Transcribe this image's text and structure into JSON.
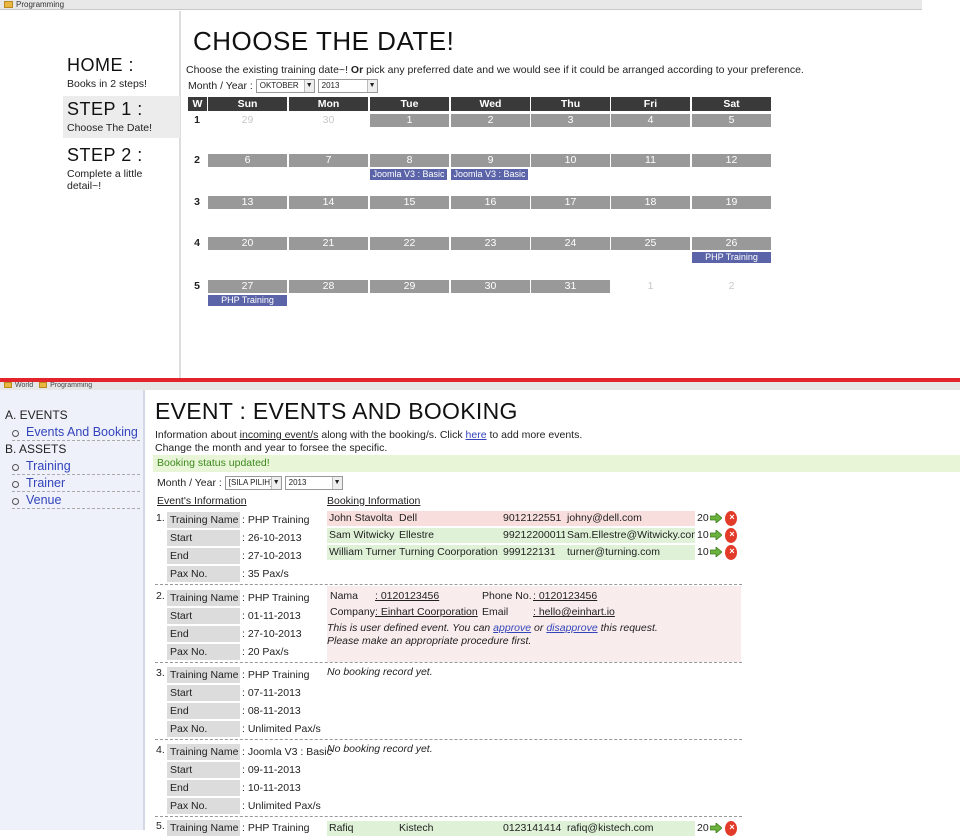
{
  "top": {
    "bookmark": "Programming",
    "steps": [
      {
        "heading": "HOME :",
        "sub": "Books in 2 steps!"
      },
      {
        "heading": "STEP 1 :",
        "sub": "Choose The Date!"
      },
      {
        "heading": "STEP 2 :",
        "sub": "Complete a little detail~!"
      }
    ],
    "title": "CHOOSE THE DATE!",
    "intro_a": "Choose the existing training date~!",
    "intro_or": "Or",
    "intro_b": "pick any preferred date and we would see if it could be arranged according to your preference.",
    "month_year_label": "Month / Year :",
    "month_value": "OKTOBER",
    "year_value": "2013",
    "calendar": {
      "headers": [
        "W",
        "Sun",
        "Mon",
        "Tue",
        "Wed",
        "Thu",
        "Fri",
        "Sat"
      ],
      "weeks": [
        {
          "w": "1",
          "days": [
            "29",
            "30",
            "1",
            "2",
            "3",
            "4",
            "5"
          ],
          "outside": [
            0,
            1
          ]
        },
        {
          "w": "2",
          "days": [
            "6",
            "7",
            "8",
            "9",
            "10",
            "11",
            "12"
          ],
          "outside": []
        },
        {
          "w": "3",
          "days": [
            "13",
            "14",
            "15",
            "16",
            "17",
            "18",
            "19"
          ],
          "outside": []
        },
        {
          "w": "4",
          "days": [
            "20",
            "21",
            "22",
            "23",
            "24",
            "25",
            "26"
          ],
          "outside": []
        },
        {
          "w": "5",
          "days": [
            "27",
            "28",
            "29",
            "30",
            "31",
            "1",
            "2"
          ],
          "outside": [
            5,
            6
          ]
        }
      ],
      "events": [
        {
          "week": 1,
          "day": 2,
          "label": "Joomla V3 : Basic"
        },
        {
          "week": 1,
          "day": 3,
          "label": "Joomla V3 : Basic"
        },
        {
          "week": 3,
          "day": 6,
          "label": "PHP Training"
        },
        {
          "week": 4,
          "day": 0,
          "label": "PHP Training"
        }
      ]
    }
  },
  "bottom": {
    "bookmarks": [
      "World",
      "Programming"
    ],
    "sidebar": {
      "sec_a": "A.  EVENTS",
      "events_link": "Events And Booking",
      "sec_b": "B.  ASSETS",
      "training": "Training",
      "trainer": "Trainer",
      "venue": "Venue"
    },
    "title": "EVENT : EVENTS AND BOOKING",
    "info1_a": "Information about",
    "info1_link": "incoming event/s",
    "info1_b": "along with the booking/s. Click",
    "info1_here": "here",
    "info1_c": "to add more events.",
    "info2": "Change the month and year to forsee the specific.",
    "status": "Booking status updated!",
    "month_year_label": "Month / Year :",
    "month_value": "[SILA PILIH]",
    "year_value": "2013",
    "col_event": "Event's Information",
    "col_booking": "Booking Information",
    "labels": {
      "name": "Training Name",
      "start": "Start",
      "end": "End",
      "pax": "Pax No."
    },
    "events": [
      {
        "num": "1.",
        "name": ": PHP Training",
        "start": ": 26-10-2013",
        "end": ": 27-10-2013",
        "pax": ": 35 Pax/s"
      },
      {
        "num": "2.",
        "name": ": PHP Training",
        "start": ": 01-11-2013",
        "end": ": 27-10-2013",
        "pax": ": 20 Pax/s"
      },
      {
        "num": "3.",
        "name": ": PHP Training",
        "start": ": 07-11-2013",
        "end": ": 08-11-2013",
        "pax": ": Unlimited Pax/s"
      },
      {
        "num": "4.",
        "name": ": Joomla V3 : Basic",
        "start": ": 09-11-2013",
        "end": ": 10-11-2013",
        "pax": ": Unlimited Pax/s"
      },
      {
        "num": "5.",
        "name": ": PHP Training"
      }
    ],
    "bookings": [
      {
        "name": "John Stavolta",
        "company": "Dell",
        "phone": "9012122551",
        "email": "johny@dell.com",
        "pax": "20"
      },
      {
        "name": "Sam Witwicky",
        "company": "Ellestre",
        "phone": "99212200011",
        "email": "Sam.Ellestre@Witwicky.com",
        "pax": "10"
      },
      {
        "name": "William Turner",
        "company": "Turning Coorporation",
        "phone": "999122131",
        "email": "turner@turning.com",
        "pax": "10"
      }
    ],
    "ev2": {
      "nama_label": "Nama",
      "nama_value": ": 0120123456",
      "phone_label": "Phone No.",
      "phone_value": ": 0120123456",
      "company_label": "Company",
      "company_value": ": Einhart Coorporation",
      "email_label": "Email",
      "email_value": ": hello@einhart.io",
      "msg_a": "This is user defined event. You can",
      "approve": "approve",
      "msg_or": "or",
      "disapprove": "disapprove",
      "msg_b": "this request.",
      "msg2": "Please make an appropriate procedure first."
    },
    "no_booking": "No booking record yet.",
    "ev5_booking": {
      "name": "Rafiq",
      "company": "Kistech",
      "phone": "0123141414",
      "email": "rafiq@kistech.com",
      "pax": "20"
    }
  }
}
